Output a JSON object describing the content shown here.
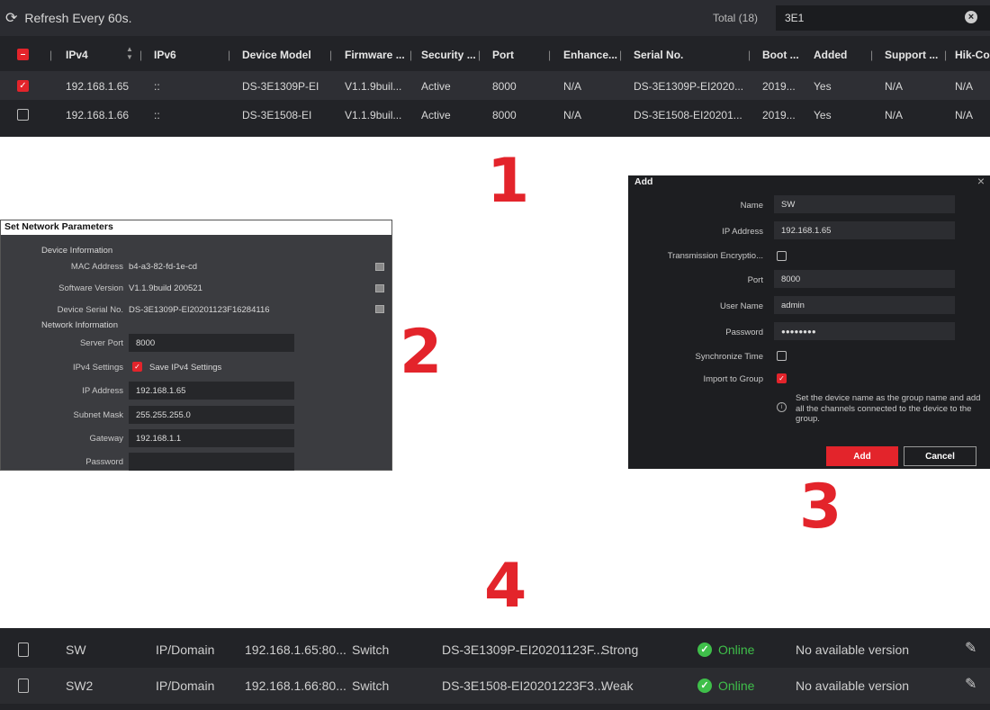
{
  "callouts": [
    "1",
    "2",
    "3",
    "4"
  ],
  "device_list": {
    "refresh_label": "Refresh Every 60s.",
    "total_label": "Total (18)",
    "search_value": "3E1",
    "columns": [
      "IPv4",
      "IPv6",
      "Device Model",
      "Firmware ...",
      "Security ...",
      "Port",
      "Enhance...",
      "Serial No.",
      "Boot ...",
      "Added",
      "Support ...",
      "Hik-Co"
    ],
    "rows": [
      {
        "checked": true,
        "cells": [
          "192.168.1.65",
          "::",
          "DS-3E1309P-EI",
          "V1.1.9buil...",
          "Active",
          "8000",
          "N/A",
          "DS-3E1309P-EI2020...",
          "2019...",
          "Yes",
          "N/A",
          "N/A"
        ]
      },
      {
        "checked": false,
        "cells": [
          "192.168.1.66",
          "::",
          "DS-3E1508-EI",
          "V1.1.9buil...",
          "Active",
          "8000",
          "N/A",
          "DS-3E1508-EI20201...",
          "2019...",
          "Yes",
          "N/A",
          "N/A"
        ]
      }
    ]
  },
  "network_params": {
    "title": "Set Network Parameters",
    "device_info_heading": "Device Information",
    "mac_label": "MAC Address",
    "mac_value": "b4-a3-82-fd-1e-cd",
    "sw_label": "Software Version",
    "sw_value": "V1.1.9build 200521",
    "serial_label": "Device Serial No.",
    "serial_value": "DS-3E1309P-EI20201123F16284116",
    "network_info_heading": "Network Information",
    "port_label": "Server Port",
    "port_value": "8000",
    "ipv4_label": "IPv4 Settings",
    "ipv4_checkbox_label": "Save IPv4 Settings",
    "ip_label": "IP Address",
    "ip_value": "192.168.1.65",
    "mask_label": "Subnet Mask",
    "mask_value": "255.255.255.0",
    "gateway_label": "Gateway",
    "gateway_value": "192.168.1.1",
    "password_label": "Password",
    "password_value": ""
  },
  "add_dialog": {
    "title": "Add",
    "name_label": "Name",
    "name_value": "SW",
    "ip_label": "IP Address",
    "ip_value": "192.168.1.65",
    "encryption_label": "Transmission Encryptio...",
    "port_label": "Port",
    "port_value": "8000",
    "user_label": "User Name",
    "user_value": "admin",
    "password_label": "Password",
    "password_value": "●●●●●●●●",
    "sync_label": "Synchronize Time",
    "group_label": "Import to Group",
    "hint": "Set the device name as the group name and add all the channels connected to the device to the group.",
    "add_button": "Add",
    "cancel_button": "Cancel"
  },
  "managed": {
    "rows": [
      {
        "name": "SW",
        "type": "IP/Domain",
        "address": "192.168.1.65:80...",
        "category": "Switch",
        "serial": "DS-3E1309P-EI20201123F...",
        "security": "Strong",
        "status": "Online",
        "firmware": "No available version"
      },
      {
        "name": "SW2",
        "type": "IP/Domain",
        "address": "192.168.1.66:80...",
        "category": "Switch",
        "serial": "DS-3E1508-EI20201223F3...",
        "security": "Weak",
        "status": "Online",
        "firmware": "No available version"
      }
    ]
  },
  "colors": {
    "accent": "#e3242b",
    "online": "#3fbf4a"
  }
}
